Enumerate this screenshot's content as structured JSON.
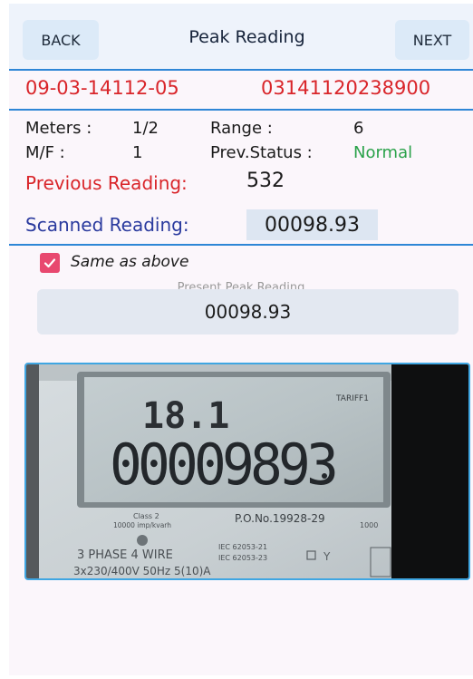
{
  "header": {
    "back_label": "BACK",
    "title": "Peak Reading",
    "next_label": "NEXT"
  },
  "ids": {
    "left": "09-03-14112-05",
    "right": "03141120238900"
  },
  "meter_info": {
    "meters_label": "Meters :",
    "meters_value": "1/2",
    "range_label": "Range :",
    "range_value": "6",
    "mf_label": "M/F :",
    "mf_value": "1",
    "prev_status_label": "Prev.Status :",
    "prev_status_value": "Normal"
  },
  "readings": {
    "previous_label": "Previous Reading:",
    "previous_value": "532",
    "scanned_label": "Scanned Reading:",
    "scanned_value": "00098.93"
  },
  "form": {
    "same_as_above_label": "Same as above",
    "same_as_above_checked": true,
    "present_peak_label": "Present Peak Reading",
    "present_peak_value": "00098.93"
  },
  "photo": {
    "lcd_small": "18.1",
    "lcd_big": "00009893",
    "tariff": "TARIFF1",
    "class_text": "Class 2",
    "imp_text": "10000 imp/kvarh",
    "po_text": "P.O.No.19928-29",
    "phase_text": "3 PHASE  4 WIRE",
    "iec1": "IEC 62053-21",
    "iec2": "IEC 62053-23",
    "spec_text": "3x230/400V  50Hz  5(10)A",
    "edge_text": "1000"
  },
  "colors": {
    "accent_blue": "#2e86d6",
    "id_red": "#d9252a",
    "normal_green": "#2aa24a",
    "scanned_blue": "#2a3a9e",
    "checkbox_pink": "#e8486f"
  }
}
